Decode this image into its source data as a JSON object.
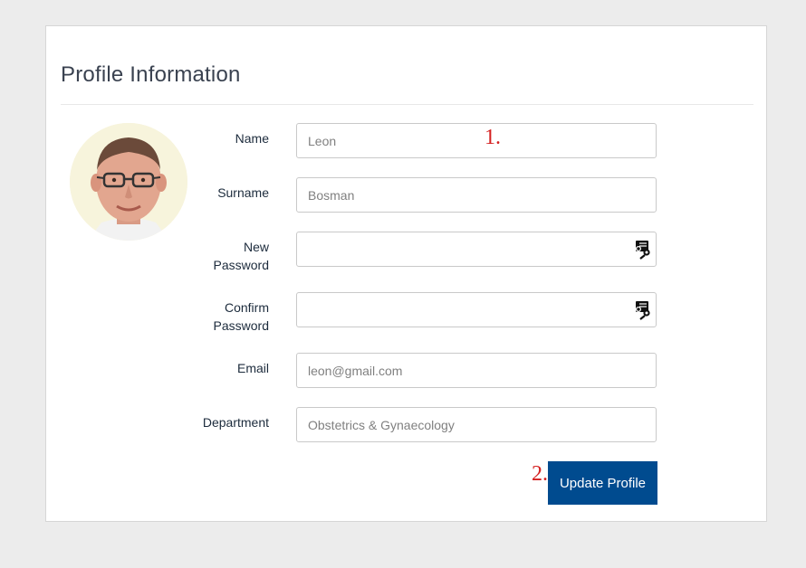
{
  "card": {
    "title": "Profile Information"
  },
  "fields": {
    "name": {
      "label": "Name",
      "value": "Leon"
    },
    "surname": {
      "label": "Surname",
      "value": "Bosman"
    },
    "new_password": {
      "label_line1": "New",
      "label_line2": "Password",
      "value": ""
    },
    "confirm_password": {
      "label_line1": "Confirm",
      "label_line2": "Password",
      "value": ""
    },
    "email": {
      "label": "Email",
      "value": "leon@gmail.com"
    },
    "department": {
      "label": "Department",
      "value": "Obstetrics & Gynaecology"
    }
  },
  "annotations": {
    "one": "1.",
    "two": "2."
  },
  "actions": {
    "update_label": "Update Profile"
  },
  "icons": {
    "password_toggle": "key-card-icon",
    "avatar": "profile-photo"
  },
  "colors": {
    "primary_button": "#004b8f",
    "annotation": "#d42020"
  }
}
